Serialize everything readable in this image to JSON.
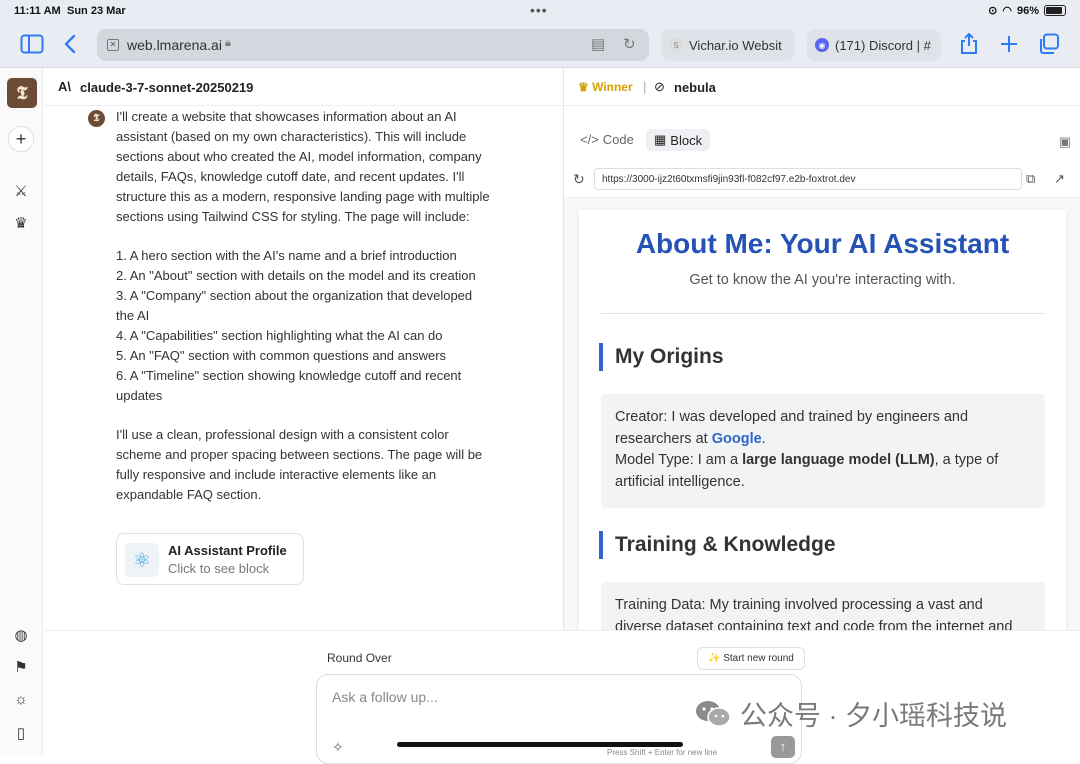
{
  "status_bar": {
    "time": "11:11 AM",
    "date": "Sun 23 Mar",
    "battery": "96%"
  },
  "browser": {
    "address": "web.lmarena.ai",
    "tabs": [
      {
        "label": "Vichar.io Websit"
      },
      {
        "label": "(171) Discord | #"
      }
    ]
  },
  "chat": {
    "model_name": "claude-3-7-sonnet-20250219",
    "message": {
      "intro": "I'll create a website that showcases information about an AI assistant (based on my own characteristics). This will include sections about who created the AI, model information, company details, FAQs, knowledge cutoff date, and recent updates. I'll structure this as a modern, responsive landing page with multiple sections using Tailwind CSS for styling. The page will include:",
      "list": [
        "1. A hero section with the AI's name and a brief introduction",
        "2. An \"About\" section with details on the model and its creation",
        "3. A \"Company\" section about the organization that developed the AI",
        "4. A \"Capabilities\" section highlighting what the AI can do",
        "5. An \"FAQ\" section with common questions and answers",
        "6. A \"Timeline\" section showing knowledge cutoff and recent updates"
      ],
      "outro": "I'll use a clean, professional design with a consistent color scheme and proper spacing between sections. The page will be fully responsive and include interactive elements like an expandable FAQ section."
    },
    "block_card": {
      "title": "AI Assistant Profile",
      "subtitle": "Click to see block"
    }
  },
  "right_pane": {
    "winner_label": "Winner",
    "separator": "|",
    "model_name": "nebula",
    "tabs": {
      "code": "Code",
      "block": "Block"
    },
    "url": "https://3000-ijz2t60txmsfi9jin93fl-f082cf97.e2b-foxtrot.dev",
    "preview": {
      "title": "About Me: Your AI Assistant",
      "subtitle": "Get to know the AI you're interacting with.",
      "origins_heading": "My Origins",
      "origins": {
        "creator_prefix": "Creator: I was developed and trained by engineers and researchers at ",
        "creator_link": "Google",
        "creator_suffix": ".",
        "model_prefix": "Model Type: I am a ",
        "model_bold": "large language model (LLM)",
        "model_suffix": ", a type of artificial intelligence."
      },
      "training_heading": "Training & Knowledge",
      "training_text": "Training Data: My training involved processing a vast and diverse dataset containing text and code from the internet and"
    }
  },
  "composer": {
    "round_over": "Round Over",
    "start_new_round": "Start new round",
    "placeholder": "Ask a follow up...",
    "hint": "Press Shift + Enter for new line"
  },
  "watermark": {
    "text": "公众号 · 夕小瑶科技说"
  },
  "colors": {
    "accent": "#2f7bf5",
    "preview_title": "#2452b5",
    "winner": "#d7a100"
  }
}
